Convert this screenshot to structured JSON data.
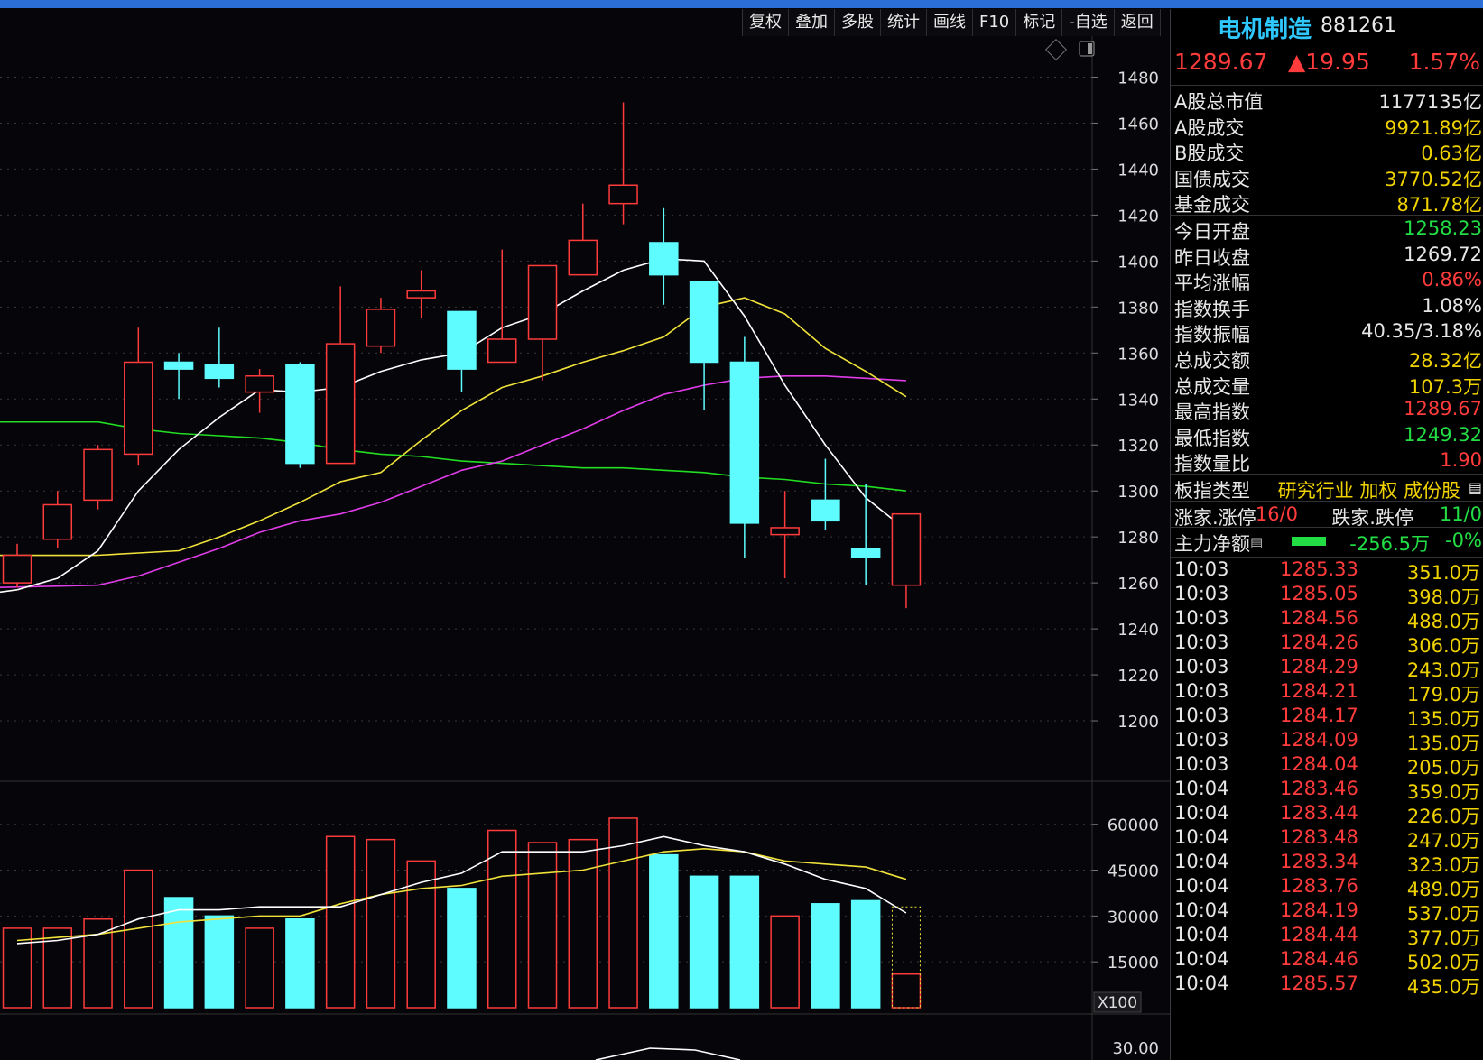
{
  "toolbar": [
    "复权",
    "叠加",
    "多股",
    "统计",
    "画线",
    "F10",
    "标记",
    "-自选",
    "返回"
  ],
  "panel": {
    "name": "电机制造",
    "code": "881261",
    "price": "1289.67",
    "change": "▲19.95",
    "change_pct": "1.57%",
    "market": [
      {
        "label": "A股总市值",
        "value": "1177135亿",
        "color": "white"
      },
      {
        "label": "A股成交",
        "value": "9921.89亿",
        "color": "yellow"
      },
      {
        "label": "B股成交",
        "value": "0.63亿",
        "color": "yellow"
      },
      {
        "label": "国债成交",
        "value": "3770.52亿",
        "color": "yellow"
      },
      {
        "label": "基金成交",
        "value": "871.78亿",
        "color": "yellow"
      }
    ],
    "stats": [
      {
        "label": "今日开盘",
        "value": "1258.23",
        "color": "green"
      },
      {
        "label": "昨日收盘",
        "value": "1269.72",
        "color": "white"
      },
      {
        "label": "平均涨幅",
        "value": "0.86%",
        "color": "red"
      },
      {
        "label": "指数换手",
        "value": "1.08%",
        "color": "white"
      },
      {
        "label": "指数振幅",
        "value": "40.35/3.18%",
        "color": "white"
      },
      {
        "label": "总成交额",
        "value": "28.32亿",
        "color": "yellow"
      },
      {
        "label": "总成交量",
        "value": "107.3万",
        "color": "yellow"
      },
      {
        "label": "最高指数",
        "value": "1289.67",
        "color": "red"
      },
      {
        "label": "最低指数",
        "value": "1249.32",
        "color": "green"
      },
      {
        "label": "指数量比",
        "value": "1.90",
        "color": "red"
      }
    ],
    "type_label": "板指类型",
    "type_value": "研究行业 加权 成份股",
    "updown_label": "涨家.涨停",
    "updown_value": "16/0",
    "down_label": "跌家.跌停",
    "down_value": "11/0",
    "flow_label": "主力净额",
    "flow_value": "-256.5万",
    "flow_pct": "-0%",
    "ticks": [
      {
        "t": "10:03",
        "p": "1285.33",
        "q": "351.0万"
      },
      {
        "t": "10:03",
        "p": "1285.05",
        "q": "398.0万"
      },
      {
        "t": "10:03",
        "p": "1284.56",
        "q": "488.0万"
      },
      {
        "t": "10:03",
        "p": "1284.26",
        "q": "306.0万"
      },
      {
        "t": "10:03",
        "p": "1284.29",
        "q": "243.0万"
      },
      {
        "t": "10:03",
        "p": "1284.21",
        "q": "179.0万"
      },
      {
        "t": "10:03",
        "p": "1284.17",
        "q": "135.0万"
      },
      {
        "t": "10:03",
        "p": "1284.09",
        "q": "135.0万"
      },
      {
        "t": "10:03",
        "p": "1284.04",
        "q": "205.0万"
      },
      {
        "t": "10:04",
        "p": "1283.46",
        "q": "359.0万"
      },
      {
        "t": "10:04",
        "p": "1283.44",
        "q": "226.0万"
      },
      {
        "t": "10:04",
        "p": "1283.48",
        "q": "247.0万"
      },
      {
        "t": "10:04",
        "p": "1283.34",
        "q": "323.0万"
      },
      {
        "t": "10:04",
        "p": "1283.76",
        "q": "489.0万"
      },
      {
        "t": "10:04",
        "p": "1284.19",
        "q": "537.0万"
      },
      {
        "t": "10:04",
        "p": "1284.44",
        "q": "377.0万"
      },
      {
        "t": "10:04",
        "p": "1284.46",
        "q": "502.0万"
      },
      {
        "t": "10:04",
        "p": "1285.57",
        "q": "435.0万"
      }
    ]
  },
  "colors": {
    "up": "#ff3b3b",
    "down": "#5ffcff",
    "ma5": "#ffffff",
    "ma10": "#f0e23a",
    "ma20": "#e03ce8",
    "ma60": "#22dd22"
  },
  "chart_data": [
    {
      "type": "candlestick",
      "ylim": [
        1180,
        1490
      ],
      "y_ticks": [
        1200,
        1220,
        1240,
        1260,
        1280,
        1300,
        1320,
        1340,
        1360,
        1380,
        1400,
        1420,
        1440,
        1460,
        1480
      ],
      "candles": [
        {
          "o": 1260,
          "c": 1272,
          "h": 1277,
          "l": 1258
        },
        {
          "o": 1279,
          "c": 1294,
          "h": 1300,
          "l": 1275
        },
        {
          "o": 1296,
          "c": 1318,
          "h": 1320,
          "l": 1292
        },
        {
          "o": 1316,
          "c": 1356,
          "h": 1371,
          "l": 1311
        },
        {
          "o": 1356,
          "c": 1353,
          "h": 1360,
          "l": 1340
        },
        {
          "o": 1355,
          "c": 1349,
          "h": 1371,
          "l": 1345
        },
        {
          "o": 1343,
          "c": 1350,
          "h": 1353,
          "l": 1334
        },
        {
          "o": 1355,
          "c": 1312,
          "h": 1356,
          "l": 1310
        },
        {
          "o": 1312,
          "c": 1364,
          "h": 1389,
          "l": 1312
        },
        {
          "o": 1363,
          "c": 1379,
          "h": 1384,
          "l": 1360
        },
        {
          "o": 1384,
          "c": 1387,
          "h": 1396,
          "l": 1375
        },
        {
          "o": 1378,
          "c": 1353,
          "h": 1378,
          "l": 1343
        },
        {
          "o": 1356,
          "c": 1366,
          "h": 1405,
          "l": 1356
        },
        {
          "o": 1366,
          "c": 1398,
          "h": 1398,
          "l": 1348
        },
        {
          "o": 1394,
          "c": 1409,
          "h": 1425,
          "l": 1397
        },
        {
          "o": 1425,
          "c": 1433,
          "h": 1469,
          "l": 1416
        },
        {
          "o": 1408,
          "c": 1394,
          "h": 1423,
          "l": 1381
        },
        {
          "o": 1391,
          "c": 1356,
          "h": 1391,
          "l": 1335
        },
        {
          "o": 1356,
          "c": 1286,
          "h": 1367,
          "l": 1271
        },
        {
          "o": 1281,
          "c": 1284,
          "h": 1300,
          "l": 1262
        },
        {
          "o": 1296,
          "c": 1287,
          "h": 1314,
          "l": 1283
        },
        {
          "o": 1275,
          "c": 1271,
          "h": 1303,
          "l": 1259
        },
        {
          "o": 1259,
          "c": 1290,
          "h": 1290,
          "l": 1249
        }
      ],
      "ma5": [
        1257,
        1262,
        1274,
        1300,
        1318,
        1332,
        1344,
        1343,
        1345,
        1352,
        1357,
        1360,
        1371,
        1377,
        1387,
        1396,
        1401,
        1400,
        1376,
        1346,
        1320,
        1297,
        1283
      ],
      "ma10": [
        1272,
        1273,
        1274,
        1280,
        1287,
        1295,
        1304,
        1308,
        1322,
        1335,
        1345,
        1350,
        1356,
        1361,
        1367,
        1380,
        1384,
        1377,
        1362,
        1352,
        1341
      ],
      "ma20": [
        1259,
        1263,
        1269,
        1275,
        1282,
        1287,
        1290,
        1295,
        1302,
        1309,
        1313,
        1320,
        1327,
        1335,
        1342,
        1346,
        1349,
        1350,
        1350,
        1349,
        1348
      ],
      "ma60": [
        1330,
        1327,
        1325,
        1324,
        1323,
        1321,
        1318,
        1316,
        1315,
        1313,
        1312,
        1311,
        1310,
        1310,
        1309,
        1308,
        1306,
        1305,
        1303,
        1302,
        1300
      ]
    },
    {
      "type": "bar",
      "ylim": [
        0,
        67000
      ],
      "y_ticks": [
        15000,
        30000,
        45000,
        60000
      ],
      "unit": "X100",
      "volume": [
        26000,
        26000,
        29000,
        45000,
        36000,
        30000,
        26000,
        29000,
        56000,
        55000,
        48000,
        39000,
        58000,
        54000,
        55000,
        62000,
        50000,
        43000,
        43000,
        30000,
        34000,
        35000,
        11000
      ],
      "forecast_last": 33000,
      "vol_ma5": [
        21000,
        22000,
        24000,
        29000,
        32000,
        32000,
        33000,
        33000,
        33000,
        37000,
        41000,
        44000,
        51000,
        51000,
        51000,
        53000,
        56000,
        53000,
        51000,
        47000,
        42000,
        39000,
        31000
      ],
      "vol_ma10": [
        22000,
        23000,
        24000,
        26000,
        28000,
        29000,
        30000,
        30000,
        34000,
        37000,
        39000,
        40000,
        43000,
        44000,
        45000,
        48000,
        51000,
        52000,
        51000,
        48000,
        47000,
        46000,
        42000
      ]
    },
    {
      "type": "line",
      "y_ticks": [
        30.0
      ],
      "y_tick_labels": [
        "30.00"
      ]
    }
  ]
}
